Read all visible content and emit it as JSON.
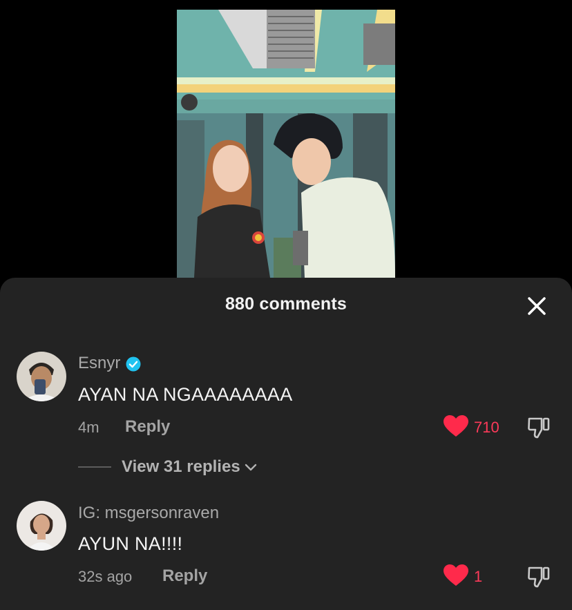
{
  "sheet": {
    "title": "880 comments"
  },
  "comments": [
    {
      "username": "Esnyr",
      "verified": true,
      "text": "AYAN NA NGAAAAAAAA",
      "time": "4m",
      "reply_label": "Reply",
      "likes": "710",
      "liked": true,
      "view_replies": "View 31 replies"
    },
    {
      "username": "IG: msgersonraven",
      "verified": false,
      "text": "AYUN NA!!!!",
      "time": "32s ago",
      "reply_label": "Reply",
      "likes": "1",
      "liked": true
    }
  ],
  "colors": {
    "sheet_bg": "#232323",
    "like_red": "#ff3a5a",
    "verified_blue": "#20c3f0"
  },
  "icons": [
    "close-icon",
    "verified-icon",
    "heart-icon",
    "dislike-icon",
    "chevron-down-icon"
  ]
}
